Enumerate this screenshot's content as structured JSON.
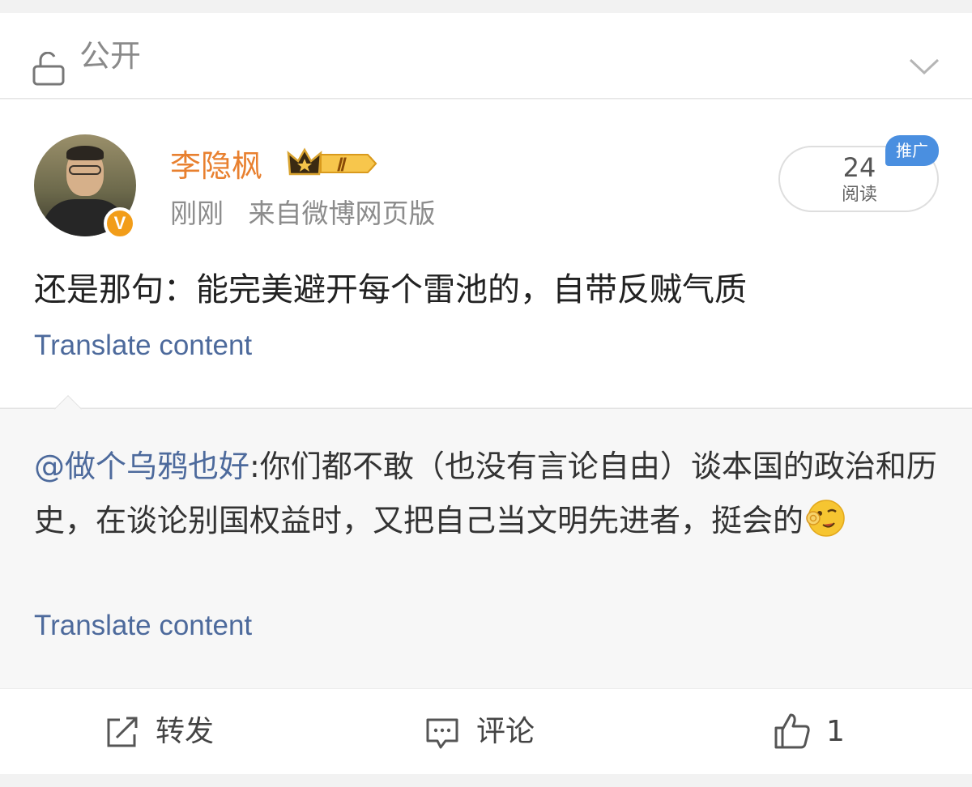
{
  "visibility": {
    "label": "公开",
    "icon": "unlock-icon",
    "dropdown_icon": "chevron-down-icon"
  },
  "post": {
    "author": {
      "name": "李隐枫",
      "verified_badge": "V",
      "level_badge": "Ⅱ",
      "badge_color": "#f29d19",
      "name_color": "#e8802f"
    },
    "time": "刚刚",
    "source": "来自微博网页版",
    "read_count": "24",
    "read_label": "阅读",
    "promo_label": "推广",
    "text": "还是那句：能完美避开每个雷池的，自带反贼气质",
    "translate_label": "Translate content"
  },
  "repost": {
    "mention": "@做个乌鸦也好",
    "text": ":你们都不敢（也没有言论自由）谈本国的政治和历史，在谈论别国权益时，又把自己当文明先进者，挺会的",
    "emoji": "wink-ok-emoji",
    "translate_label": "Translate content"
  },
  "actions": {
    "repost": {
      "label": "转发",
      "icon": "share-icon"
    },
    "comment": {
      "label": "评论",
      "icon": "comment-icon"
    },
    "like": {
      "label": "1",
      "icon": "thumbs-up-icon"
    }
  },
  "colors": {
    "link": "#4d6a9c",
    "accent": "#e8802f",
    "promo": "#4a8fe0"
  }
}
